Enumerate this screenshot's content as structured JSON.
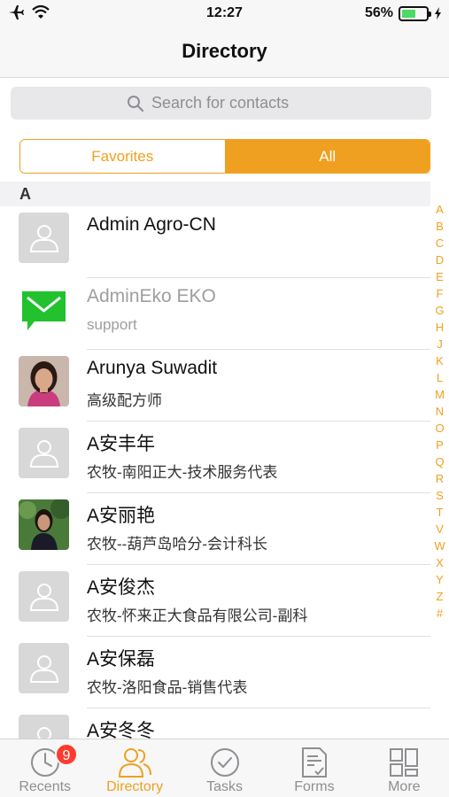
{
  "status_bar": {
    "time": "12:27",
    "battery_percent": "56%",
    "battery_level": 0.56
  },
  "nav": {
    "title": "Directory"
  },
  "search": {
    "placeholder": "Search for contacts"
  },
  "segments": {
    "favorites": "Favorites",
    "all": "All",
    "selected": "All"
  },
  "section": {
    "letter": "A"
  },
  "contacts": [
    {
      "name": "Admin Agro-CN",
      "subtitle": "",
      "avatar": "person-placeholder-icon",
      "muted": false
    },
    {
      "name": "AdminEko EKO",
      "subtitle": "support",
      "avatar": "message-envelope-icon",
      "muted": true
    },
    {
      "name": "Arunya Suwadit",
      "subtitle": "高级配方师",
      "avatar": "photo-woman-portrait",
      "muted": false
    },
    {
      "name": "A安丰年",
      "subtitle": "农牧-南阳正大-技术服务代表",
      "avatar": "person-placeholder-icon",
      "muted": false
    },
    {
      "name": "A安丽艳",
      "subtitle": "农牧--葫芦岛哈分-会计科长",
      "avatar": "photo-woman-outdoor",
      "muted": false
    },
    {
      "name": "A安俊杰",
      "subtitle": "农牧-怀来正大食品有限公司-副科",
      "avatar": "person-placeholder-icon",
      "muted": false
    },
    {
      "name": "A安保磊",
      "subtitle": "农牧-洛阳食品-销售代表",
      "avatar": "person-placeholder-icon",
      "muted": false
    },
    {
      "name": "A安冬冬",
      "subtitle": "",
      "avatar": "person-placeholder-icon",
      "muted": false
    }
  ],
  "alphabet": [
    "A",
    "B",
    "C",
    "D",
    "E",
    "F",
    "G",
    "H",
    "J",
    "K",
    "L",
    "M",
    "N",
    "O",
    "P",
    "Q",
    "R",
    "S",
    "T",
    "V",
    "W",
    "X",
    "Y",
    "Z",
    "#"
  ],
  "tabs": [
    {
      "label": "Recents",
      "icon": "clock-icon",
      "badge": "9"
    },
    {
      "label": "Directory",
      "icon": "people-icon",
      "active": true
    },
    {
      "label": "Tasks",
      "icon": "checkmark-circle-icon"
    },
    {
      "label": "Forms",
      "icon": "form-document-icon"
    },
    {
      "label": "More",
      "icon": "grid-icon"
    }
  ],
  "colors": {
    "accent": "#f0a020",
    "badge": "#ff3b30",
    "message_green": "#22c22e"
  }
}
